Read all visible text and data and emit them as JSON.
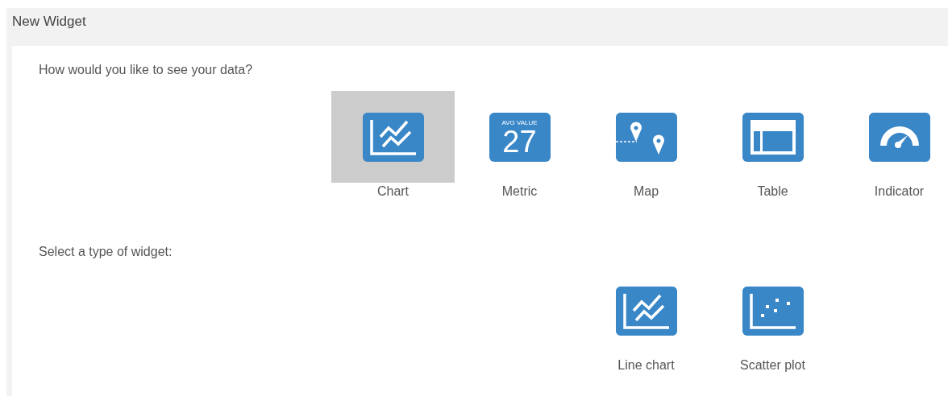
{
  "window": {
    "title": "New Widget"
  },
  "view_prompt": "How would you like to see your data?",
  "views": [
    {
      "kind": "chart",
      "label": "Chart",
      "selected": true
    },
    {
      "kind": "metric",
      "label": "Metric",
      "selected": false,
      "icon_caption": "AVG VALUE",
      "icon_value": "27"
    },
    {
      "kind": "map",
      "label": "Map",
      "selected": false
    },
    {
      "kind": "table",
      "label": "Table",
      "selected": false
    },
    {
      "kind": "indicator",
      "label": "Indicator",
      "selected": false
    }
  ],
  "type_prompt": "Select a type of widget:",
  "widget_types": [
    {
      "kind": "line",
      "label": "Line chart",
      "selected": false
    },
    {
      "kind": "scatter",
      "label": "Scatter plot",
      "selected": false
    }
  ]
}
